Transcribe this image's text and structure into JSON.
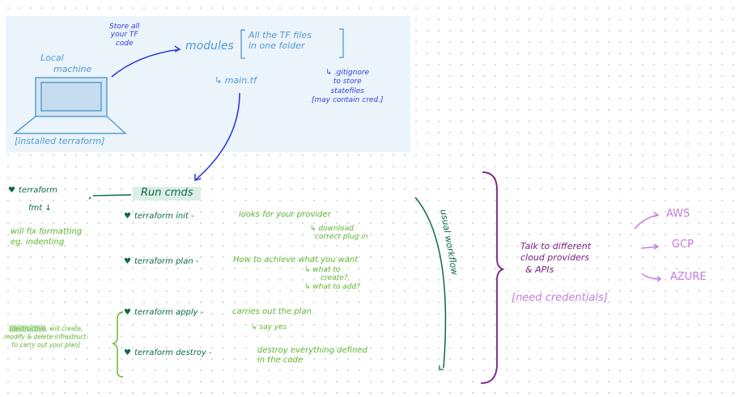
{
  "local": {
    "store_note": [
      "Store all",
      "your TF",
      "code"
    ],
    "machine_label": [
      "Local",
      "machine"
    ],
    "installed": "[installed terraform]",
    "modules": "modules",
    "modules_note": [
      "All the TF files",
      "in one folder"
    ],
    "main_tf": "↳ main.tf",
    "gitignore": [
      "↳ .gitignore",
      "to store",
      "statefiles",
      "[may contain cred.]"
    ]
  },
  "commands": {
    "run_cmds": "Run cmds",
    "fmt": {
      "cmd": "terraform",
      "cmd2": "fmt ↓",
      "desc": [
        "will fix formatting",
        "eg. indenting"
      ]
    },
    "init": {
      "cmd": "terraform init -",
      "desc": "looks for your provider",
      "sub": [
        "↳ download",
        "correct plug in"
      ]
    },
    "plan": {
      "cmd": "terraform plan -",
      "desc": "How to achieve what you want",
      "sub": [
        "↳ what to",
        "create?",
        "↳ what to add?"
      ]
    },
    "apply": {
      "cmd": "terraform apply -",
      "desc": "carries out the plan",
      "sub": "↳ say yes"
    },
    "destroy": {
      "cmd": "terraform destroy -",
      "desc": [
        "destroy everything defined",
        "in the code"
      ]
    },
    "destructive_note": {
      "highlight": "[destructive",
      "rest": ", will create,",
      "line2": "modify & delete infrastruct.",
      "line3": "to carry out your plan]"
    }
  },
  "workflow_label": "usual workflow",
  "providers": {
    "talk": [
      "Talk to different",
      "cloud providers",
      "& APIs"
    ],
    "credentials": "[need credentials]",
    "list": [
      "AWS",
      "GCP",
      "AZURE"
    ]
  },
  "colors": {
    "dark_blue": "#2f3fd8",
    "light_blue": "#4f9bd0",
    "dark_green": "#0b6b47",
    "light_green": "#5cb52c",
    "purple": "#7c1f82",
    "light_purple": "#c57ce0",
    "panel": "#eaf2fb"
  }
}
